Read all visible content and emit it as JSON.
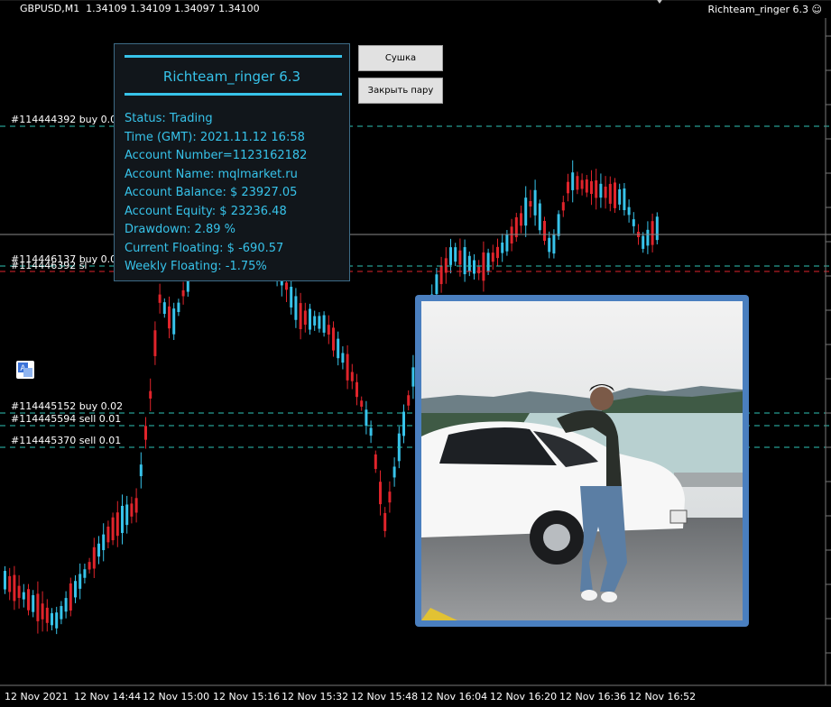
{
  "header": {
    "symbol_line": "GBPUSD,M1  1.34109 1.34109 1.34097 1.34100",
    "ea_name": "Richteam_ringer 6.3",
    "ea_icon": "smiley-icon"
  },
  "panel": {
    "title": "Richteam_ringer 6.3",
    "lines": [
      "Status: Trading",
      "Time (GMT): 2021.11.12 16:58",
      "Account Number=1123162182",
      "Account Name: mqlmarket.ru",
      "Account Balance: $ 23927.05",
      "Account Equity: $ 23236.48",
      "Drawdown: 2.89 %",
      "Current Floating: $ -690.57",
      "Weekly Floating: -1.75%"
    ]
  },
  "buttons": {
    "dry_label": "Сушка",
    "close_pair_label": "Закрыть пару"
  },
  "trade_labels": [
    {
      "text": "#114444392 buy 0.01"
    },
    {
      "text": "#114446137 buy 0.01"
    },
    {
      "text": "#114445152 buy 0.02"
    },
    {
      "text": "#114445594 sell 0.01"
    },
    {
      "text": "#114445370 sell 0.01"
    }
  ],
  "overlap_label": {
    "text": "#114446392 sl"
  },
  "time_axis": [
    "12 Nov 2021",
    "12 Nov 14:44",
    "12 Nov 15:00",
    "12 Nov 15:16",
    "12 Nov 15:32",
    "12 Nov 15:48",
    "12 Nov 16:04",
    "12 Nov 16:20",
    "12 Nov 16:36",
    "12 Nov 16:52"
  ],
  "colors": {
    "bull": "#37c3ea",
    "bear": "#e0242b",
    "line": "#2ec4b6",
    "sl": "#e0242b",
    "photo_border": "#4a7fbf"
  }
}
